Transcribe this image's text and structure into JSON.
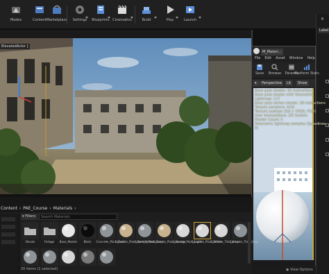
{
  "toolbar": {
    "items": [
      {
        "label": "Modes",
        "icon": "modes-icon"
      },
      {
        "label": "Content",
        "icon": "content-icon"
      },
      {
        "label": "Marketplace",
        "icon": "marketplace-icon"
      },
      {
        "label": "Settings",
        "icon": "settings-icon"
      },
      {
        "label": "Blueprints",
        "icon": "blueprints-icon"
      },
      {
        "label": "Cinematics",
        "icon": "cinematics-icon"
      },
      {
        "label": "Build",
        "icon": "build-icon"
      },
      {
        "label": "Play",
        "icon": "play-icon"
      },
      {
        "label": "Launch",
        "icon": "launch-icon"
      }
    ]
  },
  "viewport": {
    "tab_label": "ElevatedActor ]"
  },
  "right_panel": {
    "label": "Label"
  },
  "material_editor": {
    "tab": "M_Materi...",
    "menu": [
      "File",
      "Edit",
      "Asset",
      "Window",
      "Help"
    ],
    "tools": [
      {
        "label": "Save",
        "icon": "save-icon"
      },
      {
        "label": "Browse",
        "icon": "browse-icon"
      },
      {
        "label": "Params",
        "icon": "params-icon"
      },
      {
        "label": "Platform Stats",
        "icon": "platform-stats-icon"
      }
    ],
    "viewport_buttons": [
      "Perspective",
      "Lit",
      "Show"
    ],
    "stats": [
      "Base pass shader: 94 instructions",
      "Base pass shader with Volumetric Lightmap: 117",
      "Base pass vertex shader: 30 instructions",
      "Texture samplers: 4/16",
      "Texture Lookups (Est.): VS(0), PS(2)",
      "User interpolators: 2/4 Scalars",
      "Shader Count: 5",
      "Volumetric lightmap samples (Speedtree 5)"
    ]
  },
  "content_browser": {
    "breadcrumb": [
      "Content",
      "PAE_Course",
      "Materials"
    ],
    "filters_label": "Filters",
    "search_placeholder": "Search Materials",
    "assets_row1": [
      {
        "name": "Decals",
        "kind": "folder"
      },
      {
        "name": "Foliage",
        "kind": "folder"
      },
      {
        "name": "Base_Master",
        "kind": "white"
      },
      {
        "name": "Black",
        "kind": "black"
      },
      {
        "name": "Concrete_Plain_Dark",
        "kind": "grey"
      },
      {
        "name": "Concrete_Plain_Dark_Yellow",
        "kind": "tan"
      },
      {
        "name": "Concrete_Plain_Grey",
        "kind": "grey"
      },
      {
        "name": "Concrete_Plain_Orange",
        "kind": "tan"
      },
      {
        "name": "Concrete_Plain_Light",
        "kind": "light"
      },
      {
        "name": "Concrete_Plain_White",
        "kind": "light",
        "selected": true
      },
      {
        "name": "Concrete_Tiles_Grey",
        "kind": "light"
      },
      {
        "name": "Concrete_Tiles_Grey",
        "kind": "grey"
      }
    ],
    "assets_row2": [
      {
        "name": "",
        "kind": "grey"
      },
      {
        "name": "",
        "kind": "grey"
      },
      {
        "name": "",
        "kind": "light"
      },
      {
        "name": "",
        "kind": "pattern"
      },
      {
        "name": "",
        "kind": "grey"
      }
    ],
    "status": "20 items (1 selected)",
    "view_options": "View Options"
  },
  "colors": {
    "toolbar_bg": "#202020",
    "panel_bg": "#1e1e1e",
    "selection": "#d7a93a",
    "icon_blue": "#5b8fd8"
  }
}
